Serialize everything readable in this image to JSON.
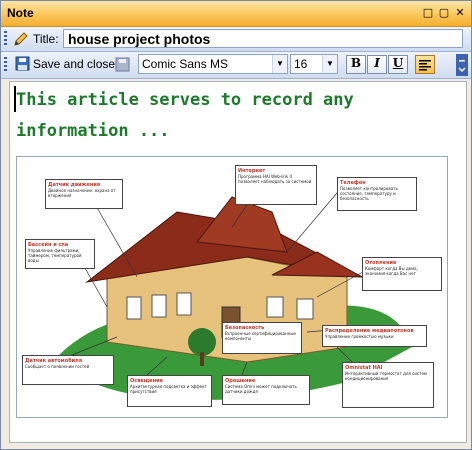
{
  "window": {
    "title": "Note"
  },
  "title_bar_buttons": [
    {
      "name": "pin-icon",
      "glyph": "□"
    },
    {
      "name": "dock-icon",
      "glyph": "▢"
    },
    {
      "name": "close-icon",
      "glyph": "✕"
    }
  ],
  "title_row": {
    "label": "Title:",
    "value": "house project photos"
  },
  "toolbar": {
    "save_label": "Save and close",
    "font_family": "Comic Sans MS",
    "font_size": "16",
    "bold": "B",
    "italic": "I",
    "underline": "U"
  },
  "content": {
    "text": "This article serves to record any information ...",
    "illustration_callouts": [
      {
        "h": "Интернет",
        "b": "Программа HAI Web-link II позволяет наблюдать за системой"
      },
      {
        "h": "Телефон",
        "b": "Позволяет контролировать состояние, температуру и безопасность"
      },
      {
        "h": "Датчик движения",
        "b": "Двойное назначение: охрана от вторжения"
      },
      {
        "h": "Бассейн и спа",
        "b": "Управление фильтрами, таймером, температурой воды"
      },
      {
        "h": "Отопление",
        "b": "Комфорт когда Вы дома, экономия когда Вас нет"
      },
      {
        "h": "Безопасность",
        "b": "Встроенные сертифицированные компоненты"
      },
      {
        "h": "Распределение медиапотоков",
        "b": "Управление громкостью музыки"
      },
      {
        "h": "Датчик автомобиля",
        "b": "Сообщает о появлении гостей"
      },
      {
        "h": "Освещение",
        "b": "Архитектурная подсветка и эффект присутствия"
      },
      {
        "h": "Орошение",
        "b": "Система Omni может подключать датчики дождя"
      },
      {
        "h": "Omnistat HAI",
        "b": "Интерактивный термостат для систем кондиционирования"
      }
    ]
  },
  "colors": {
    "text_green": "#1d7a2b",
    "titlebar": "#f5ae2e",
    "toolbar": "#cfdcf1"
  }
}
